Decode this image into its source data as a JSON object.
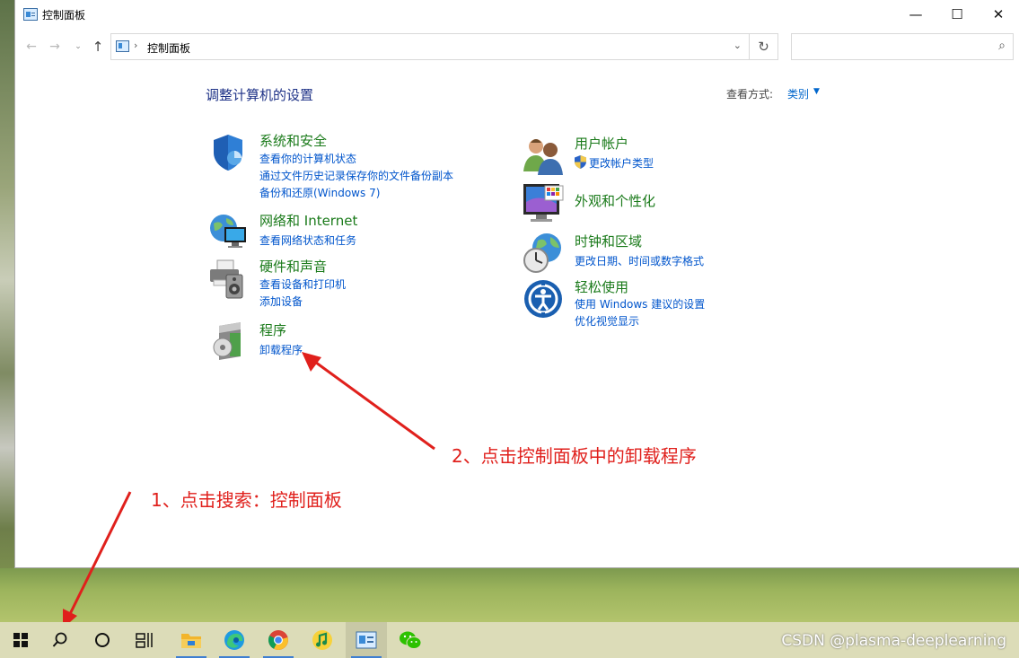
{
  "window": {
    "title": "控制面板",
    "controls": {
      "minimize": "—",
      "maximize": "☐",
      "close": "✕"
    }
  },
  "addressbar": {
    "back": "←",
    "forward": "→",
    "dropdown": "⌄",
    "up": "↑",
    "separator": "›",
    "breadcrumb": "控制面板",
    "chevron": "⌄",
    "refresh": "↻",
    "search_placeholder": "",
    "search_icon": "⌕"
  },
  "content": {
    "heading": "调整计算机的设置",
    "view_by_label": "查看方式:",
    "view_by_value": "类别",
    "view_by_caret": "▼"
  },
  "categories": [
    {
      "icon": "shield-icon",
      "title": "系统和安全",
      "links": [
        "查看你的计算机状态",
        "通过文件历史记录保存你的文件备份副本",
        "备份和还原(Windows 7)"
      ]
    },
    {
      "icon": "network-globe-icon",
      "title": "网络和 Internet",
      "links": [
        "查看网络状态和任务"
      ]
    },
    {
      "icon": "printer-speaker-icon",
      "title": "硬件和声音",
      "links": [
        "查看设备和打印机",
        "添加设备"
      ]
    },
    {
      "icon": "programs-disc-icon",
      "title": "程序",
      "links": [
        "卸载程序"
      ]
    },
    {
      "icon": "users-icon",
      "title": "用户帐户",
      "links": [
        "更改帐户类型"
      ]
    },
    {
      "icon": "monitor-palette-icon",
      "title": "外观和个性化",
      "links": []
    },
    {
      "icon": "clock-globe-icon",
      "title": "时钟和区域",
      "links": [
        "更改日期、时间或数字格式"
      ]
    },
    {
      "icon": "ease-of-access-icon",
      "title": "轻松使用",
      "links": [
        "使用 Windows 建议的设置",
        "优化视觉显示"
      ]
    }
  ],
  "annotations": {
    "step1": "1、点击搜索：控制面板",
    "step2": "2、点击控制面板中的卸载程序"
  },
  "taskbar": {
    "items": [
      "start-icon",
      "search-icon",
      "cortana-icon",
      "task-view-icon",
      "file-explorer-icon",
      "edge-icon",
      "chrome-icon",
      "music-app-icon",
      "control-panel-icon",
      "wechat-icon"
    ],
    "active": "control-panel-icon",
    "watermark": "CSDN @plasma-deeplearning"
  },
  "colors": {
    "category_title": "#1a7a1a",
    "link": "#0055cc",
    "heading": "#1e3287",
    "annotation": "#e0201c",
    "taskbar": "#dcdcb8"
  }
}
